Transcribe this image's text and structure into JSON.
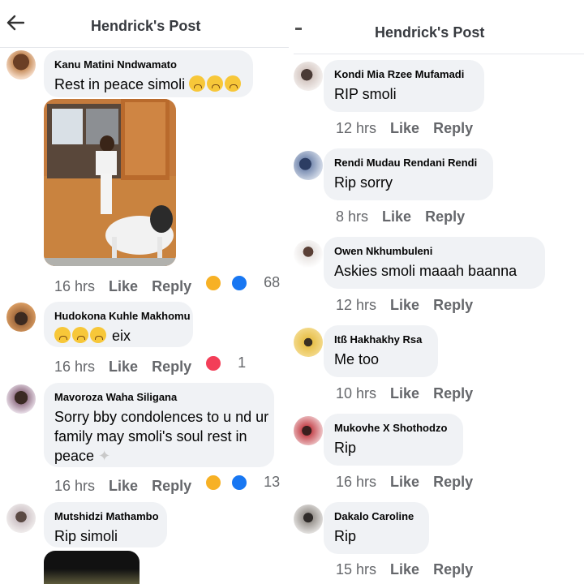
{
  "left": {
    "header": {
      "title": "Hendrick's Post"
    },
    "comments": [
      {
        "name": "Kanu Matini Nndwamato",
        "text": "Rest in peace simoli",
        "time": "16 hrs",
        "like": "Like",
        "reply": "Reply",
        "reaction_count": "68",
        "reaction_icons": [
          "haha-icon",
          "like-icon"
        ]
      },
      {
        "name": "Hudokona Kuhle Makhomu",
        "text": "eix",
        "time": "16 hrs",
        "like": "Like",
        "reply": "Reply",
        "reaction_count": "1",
        "reaction_icons": [
          "love-icon"
        ]
      },
      {
        "name": "Mavoroza Waha Siligana",
        "text": "Sorry bby condolences to u nd ur family may smoli's soul rest in peace",
        "time": "16 hrs",
        "like": "Like",
        "reply": "Reply",
        "reaction_count": "13",
        "reaction_icons": [
          "haha-icon",
          "like-icon"
        ]
      },
      {
        "name": "Mutshidzi Mathambo",
        "text": "Rip simoli"
      }
    ]
  },
  "right": {
    "header": {
      "title": "Hendrick's Post"
    },
    "comments": [
      {
        "name": "Kondi Mia Rzee Mufamadi",
        "text": "RIP smoli",
        "time": "12 hrs",
        "like": "Like",
        "reply": "Reply"
      },
      {
        "name": "Rendi Mudau Rendani Rendi",
        "text": "Rip sorry",
        "time": "8 hrs",
        "like": "Like",
        "reply": "Reply"
      },
      {
        "name": "Owen Nkhumbuleni",
        "text": "Askies smoli maaah  baanna",
        "time": "12 hrs",
        "like": "Like",
        "reply": "Reply"
      },
      {
        "name": "Itß Hakhakhy Rsa",
        "text": "Me too",
        "time": "10 hrs",
        "like": "Like",
        "reply": "Reply"
      },
      {
        "name": "Mukovhe X Shothodzo",
        "text": "Rip",
        "time": "16 hrs",
        "like": "Like",
        "reply": "Reply"
      },
      {
        "name": "Dakalo Caroline",
        "text": "Rip",
        "time": "15 hrs",
        "like": "Like",
        "reply": "Reply"
      }
    ]
  },
  "colors": {
    "bubble": "#f0f2f5",
    "meta": "#65676b",
    "love": "#f33e58",
    "like": "#1877f2",
    "haha": "#f7b125"
  }
}
